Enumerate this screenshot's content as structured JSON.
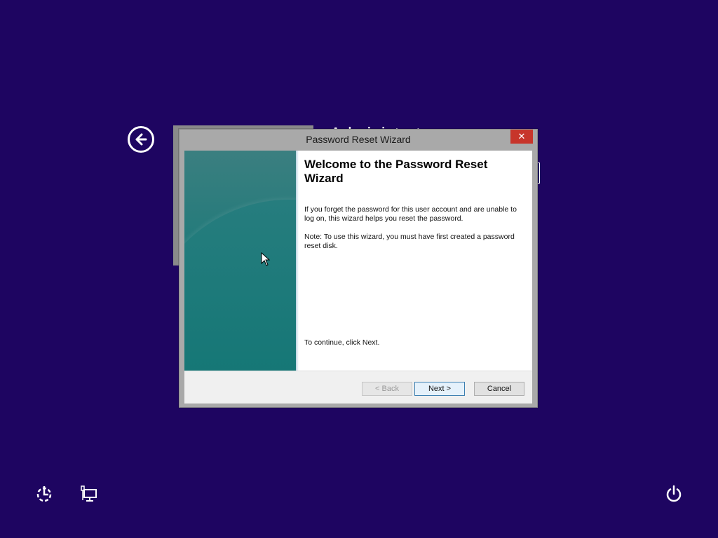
{
  "dialog": {
    "title": "Password Reset Wizard",
    "close_label": "✕",
    "heading": "Welcome to the Password Reset Wizard",
    "paragraph1": "If you forget the password for this user account and are unable to log on, this wizard helps you reset the password.",
    "paragraph2": "Note: To use this wizard, you must have first created a password reset disk.",
    "continue_text": "To continue, click Next.",
    "buttons": {
      "back": "< Back",
      "next": "Next >",
      "cancel": "Cancel"
    }
  },
  "background": {
    "user_name": "Administrator"
  },
  "icons": {
    "back": "back-arrow-icon",
    "ease_of_access": "ease-of-access-icon",
    "network": "network-icon",
    "power": "power-icon"
  },
  "colors": {
    "desktop_background": "#1e0561",
    "close_button": "#c7352b",
    "side_panel": "#117a78"
  }
}
